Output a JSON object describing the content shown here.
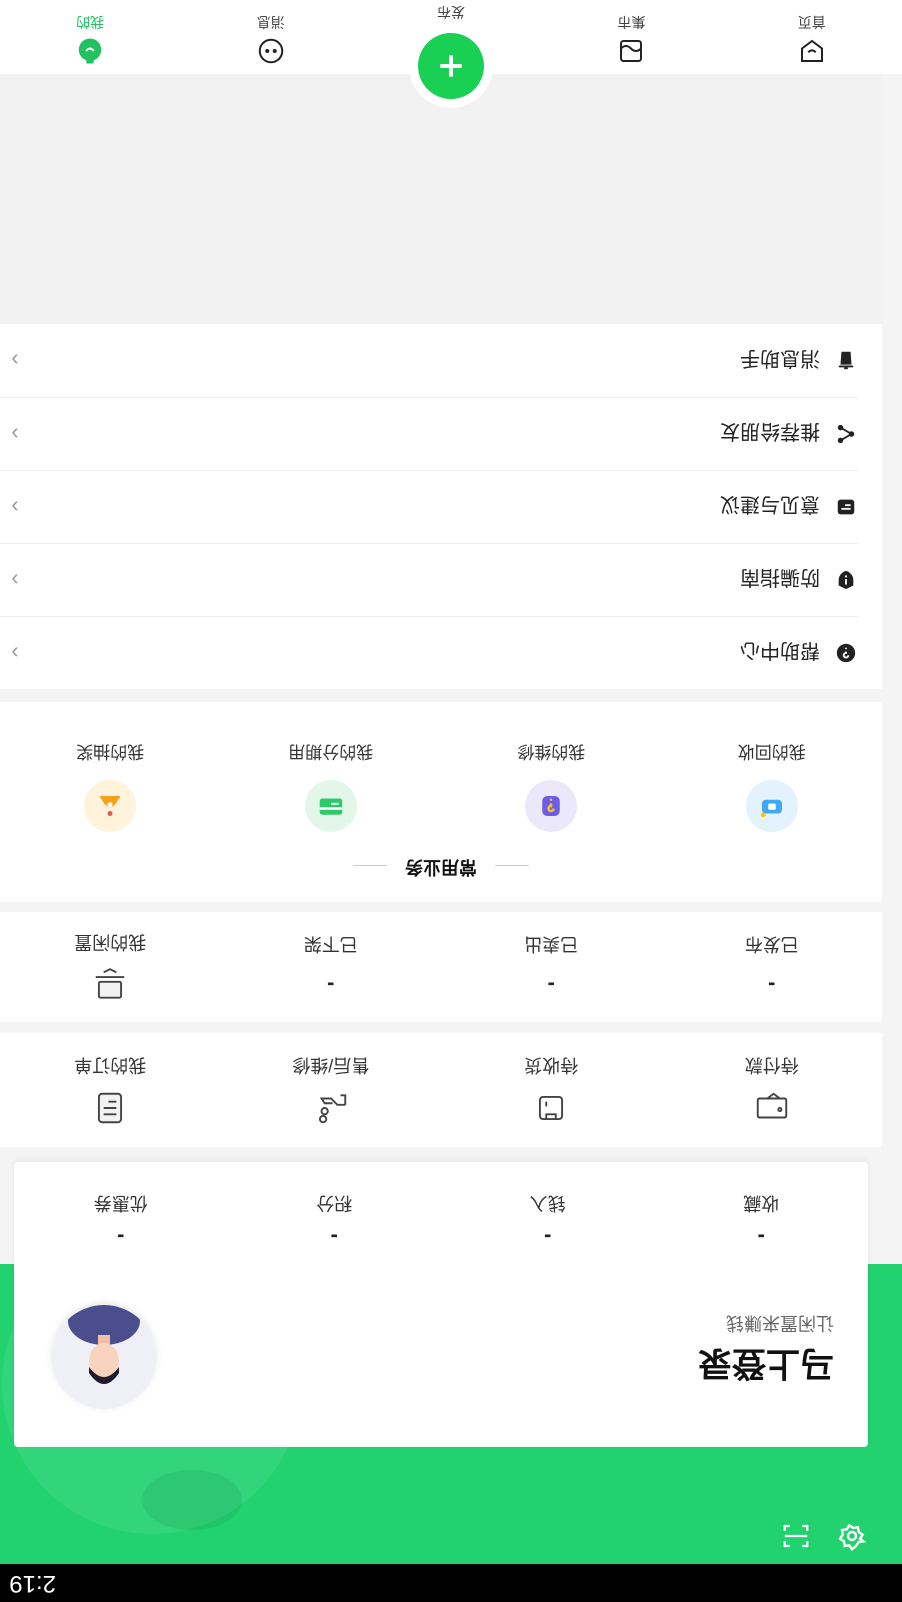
{
  "status_bar": {
    "time": "2:19"
  },
  "profile": {
    "title": "马上登录",
    "subtitle": "让闲置来赚钱",
    "stats": [
      {
        "value": "-",
        "label": "收藏"
      },
      {
        "value": "-",
        "label": "钱入"
      },
      {
        "value": "-",
        "label": "积分"
      },
      {
        "value": "-",
        "label": "优惠券"
      }
    ]
  },
  "orders": [
    {
      "label": "待付款"
    },
    {
      "label": "待收货"
    },
    {
      "label": "售后/维修"
    },
    {
      "label": "我的订单"
    }
  ],
  "listings": [
    {
      "value": "-",
      "label": "已发布"
    },
    {
      "value": "-",
      "label": "已卖出"
    },
    {
      "value": "-",
      "label": "已下架"
    },
    {
      "label": "我的闲置"
    }
  ],
  "business": {
    "title": "常用业务",
    "items": [
      {
        "label": "我的回收",
        "icon": "recycle-icon",
        "color": "#3fa9f5"
      },
      {
        "label": "我的维修",
        "icon": "repair-icon",
        "color": "#6d5ce8"
      },
      {
        "label": "我的分期用",
        "icon": "card-icon",
        "color": "#2fc86a"
      },
      {
        "label": "我的抽奖",
        "icon": "lottery-icon",
        "color": "#f7a21a"
      }
    ]
  },
  "menu": [
    {
      "label": "帮助中心",
      "icon": "help-icon"
    },
    {
      "label": "防骗指南",
      "icon": "shield-icon"
    },
    {
      "label": "意见与建议",
      "icon": "feedback-icon"
    },
    {
      "label": "推荐给朋友",
      "icon": "share-icon"
    },
    {
      "label": "消息助手",
      "icon": "trash-icon"
    }
  ],
  "tabbar": {
    "tabs": [
      {
        "label": "首页",
        "icon": "home-icon"
      },
      {
        "label": "集市",
        "icon": "market-icon"
      },
      {
        "label": "发布",
        "icon": "plus-icon"
      },
      {
        "label": "消息",
        "icon": "message-icon"
      },
      {
        "label": "我的",
        "icon": "profile-icon"
      }
    ]
  },
  "colors": {
    "accent": "#21d26f",
    "publish": "#19cf54"
  }
}
